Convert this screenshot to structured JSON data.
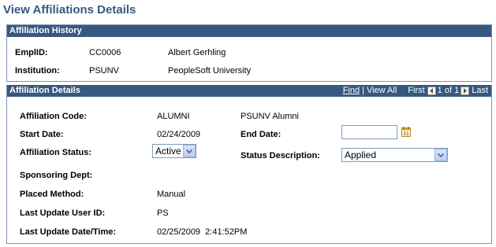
{
  "page": {
    "title": "View Affiliations Details"
  },
  "history": {
    "header": "Affiliation History",
    "emplid_label": "EmplID:",
    "emplid_value": "CC0006",
    "name": "Albert Gerhling",
    "institution_label": "Institution:",
    "institution_value": "PSUNV",
    "institution_name": "PeopleSoft University"
  },
  "details": {
    "header": "Affiliation Details",
    "nav": {
      "find": "Find",
      "separator": "|",
      "view_all": "View All",
      "first": "First",
      "count": "1 of 1",
      "last": "Last"
    },
    "code_label": "Affiliation Code:",
    "code_value": "ALUMNI",
    "code_description": "PSUNV Alumni",
    "start_label": "Start Date:",
    "start_value": "02/24/2009",
    "end_label": "End Date:",
    "end_value": "",
    "status_label": "Affiliation Status:",
    "status_value": "Active",
    "status_desc_label": "Status Description:",
    "status_desc_value": "Applied",
    "sponsoring_label": "Sponsoring Dept:",
    "placed_label": "Placed Method:",
    "placed_value": "Manual",
    "user_label": "Last Update User ID:",
    "user_value": "PS",
    "datetime_label": "Last Update Date/Time:",
    "datetime_value": "02/25/2009  2:41:52PM"
  },
  "colors": {
    "header_bg": "#36597f",
    "title_color": "#36597f",
    "border": "#7f95b2"
  },
  "icons": {
    "first_arrow": "left-arrow-icon",
    "last_arrow": "right-arrow-icon",
    "calendar": "calendar-icon",
    "dropdown": "chevron-down-icon"
  }
}
